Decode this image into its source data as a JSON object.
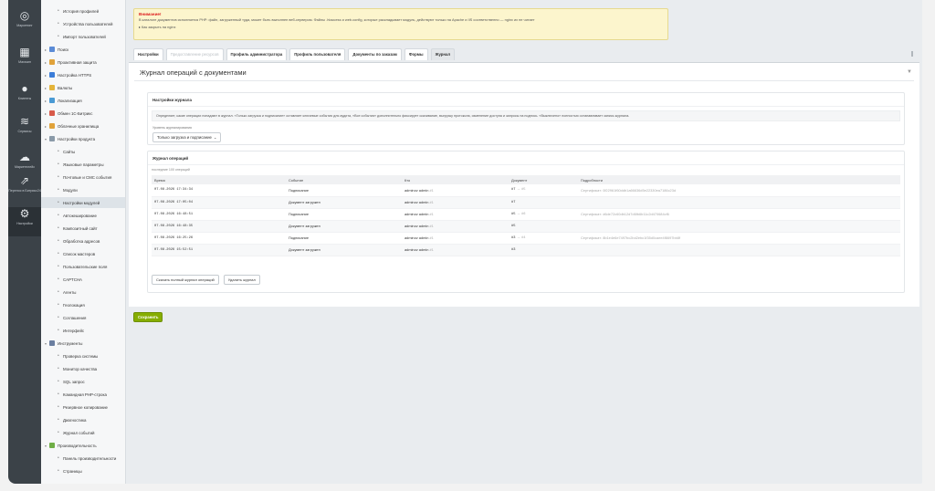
{
  "left_menu": [
    {
      "label": "Маркетинг",
      "icon": "target-icon",
      "glyph": "◎"
    },
    {
      "label": "Магазин",
      "icon": "shop-icon",
      "glyph": "▦"
    },
    {
      "label": "Клиенты",
      "icon": "clients-icon",
      "glyph": "●"
    },
    {
      "label": "Сервисы",
      "icon": "services-icon",
      "glyph": "≋"
    },
    {
      "label": "Маркетплейс",
      "icon": "marketplace-icon",
      "glyph": "☁"
    },
    {
      "label": "Перенос в Битрикс24",
      "icon": "migrate-icon",
      "glyph": "⇗"
    },
    {
      "label": "Настройки",
      "icon": "settings-icon",
      "glyph": "⚙"
    }
  ],
  "tree": [
    {
      "label": "История профилей",
      "kind": "sub"
    },
    {
      "label": "Устройства пользователей",
      "kind": "sub"
    },
    {
      "label": "Импорт пользователей",
      "kind": "sub"
    },
    {
      "label": "Поиск",
      "kind": "folder",
      "icon_color": "#5b8bd6"
    },
    {
      "label": "Проактивная защита",
      "kind": "folder",
      "icon_color": "#e0a23a"
    },
    {
      "label": "Настройка HTTPS",
      "kind": "folder",
      "icon_color": "#3b7dd8"
    },
    {
      "label": "Валюты",
      "kind": "folder",
      "icon_color": "#e4b43a"
    },
    {
      "label": "Локализация",
      "kind": "folder",
      "icon_color": "#4a9ad4"
    },
    {
      "label": "Обмен 1С-Битрикс",
      "kind": "folder",
      "icon_color": "#d85a4a"
    },
    {
      "label": "Облачные хранилища",
      "kind": "folder",
      "icon_color": "#e0a23a"
    },
    {
      "label": "Настройки продукта",
      "kind": "open",
      "icon_color": "#8a9aa8"
    },
    {
      "label": "Сайты",
      "kind": "sub"
    },
    {
      "label": "Языковые параметры",
      "kind": "sub"
    },
    {
      "label": "Почтовые и СМС события",
      "kind": "sub"
    },
    {
      "label": "Модули",
      "kind": "sub"
    },
    {
      "label": "Настройки модулей",
      "kind": "sub",
      "selected": true
    },
    {
      "label": "Автокеширование",
      "kind": "sub"
    },
    {
      "label": "Композитный сайт",
      "kind": "sub"
    },
    {
      "label": "Обработка адресов",
      "kind": "sub"
    },
    {
      "label": "Список мастеров",
      "kind": "sub"
    },
    {
      "label": "Пользовательские поля",
      "kind": "sub"
    },
    {
      "label": "CAPTCHA",
      "kind": "sub"
    },
    {
      "label": "Агенты",
      "kind": "sub"
    },
    {
      "label": "Геолокация",
      "kind": "sub"
    },
    {
      "label": "Соглашения",
      "kind": "sub"
    },
    {
      "label": "Интерфейс",
      "kind": "sub"
    },
    {
      "label": "Инструменты",
      "kind": "open",
      "icon_color": "#6a7ea0"
    },
    {
      "label": "Проверка системы",
      "kind": "sub"
    },
    {
      "label": "Монитор качества",
      "kind": "sub"
    },
    {
      "label": "SQL запрос",
      "kind": "sub"
    },
    {
      "label": "Командная PHP-строка",
      "kind": "sub"
    },
    {
      "label": "Резервное копирование",
      "kind": "sub"
    },
    {
      "label": "Диагностика",
      "kind": "sub"
    },
    {
      "label": "Журнал событий",
      "kind": "sub"
    },
    {
      "label": "Производительность",
      "kind": "open",
      "icon_color": "#6fae46"
    },
    {
      "label": "Панель производительности",
      "kind": "sub"
    },
    {
      "label": "Страницы",
      "kind": "sub"
    }
  ],
  "warning": {
    "title": "Внимание!",
    "text": "В каталоге документов исполняется PHP: файл, загруженный туда, может быть выполнен веб-сервером. Файлы .htaccess и web.config, которые раскладывает модуль, действуют только на Apache и IIS соответственно — nginx их не читает",
    "link": "▸ Как закрыть на nginx"
  },
  "tabs": [
    {
      "label": "Настройки",
      "state": "normal"
    },
    {
      "label": "Предоставление ресурсов",
      "state": "disabled"
    },
    {
      "label": "Профиль администратора",
      "state": "normal"
    },
    {
      "label": "Профиль пользователя",
      "state": "normal"
    },
    {
      "label": "Документы по заказам",
      "state": "normal"
    },
    {
      "label": "Формы",
      "state": "normal"
    },
    {
      "label": "Журнал",
      "state": "active"
    }
  ],
  "panel": {
    "title": "Журнал операций с документами",
    "settings_title": "Настройки журнала",
    "settings_desc": "Определяет, какие операции попадают в журнал. «Только загрузка и подписание» оставляет ключевые события для аудита, «Все события» дополнительно фиксирует скачивание, выгрузку протокола, изменение доступа и запросы на подпись. «Выключено» полностью останавливает запись журнала.",
    "level_label": "Уровень журналирования",
    "level_value": "Только загрузка и подписание",
    "ops_title": "Журнал операций",
    "ops_count": "последние 100 операций",
    "columns": [
      "Время",
      "Событие",
      "Кто",
      "Документ",
      "Подробности"
    ],
    "rows": [
      {
        "time": "07.08.2026 17:34:34",
        "event": "Подписание",
        "who": "adminov admin",
        "uid": "#1",
        "doc": "#7",
        "doc_to": "#5",
        "details": "Сертификат: 0f22961f60ddb1a66636d5e22330ea7186c23d"
      },
      {
        "time": "07.08.2026 17:05:04",
        "event": "Документ загружен",
        "who": "adminov admin",
        "uid": "#1",
        "doc": "#7",
        "doc_to": "",
        "details": ""
      },
      {
        "time": "07.08.2026 16:48:51",
        "event": "Подписание",
        "who": "adminov admin",
        "uid": "#1",
        "doc": "#5",
        "doc_to": "#6",
        "details": "Сертификат: d6de72c60db12d7d6fb6b11c2d470684cf6"
      },
      {
        "time": "07.08.2026 16:48:35",
        "event": "Документ загружен",
        "who": "adminov admin",
        "uid": "#1",
        "doc": "#5",
        "doc_to": "",
        "details": ""
      },
      {
        "time": "07.08.2026 16:25:26",
        "event": "Подписание",
        "who": "adminov admin",
        "uid": "#1",
        "doc": "#3",
        "doc_to": "#4",
        "details": "Сертификат: 8b1e4e6e7497bc2bd2ebc1f35d0caee4f8697bb8f"
      },
      {
        "time": "07.08.2026 15:52:51",
        "event": "Документ загружен",
        "who": "adminov admin",
        "uid": "#1",
        "doc": "#3",
        "doc_to": "",
        "details": ""
      }
    ],
    "download_label": "Скачать полный журнал операций",
    "delete_label": "Удалить журнал"
  },
  "save_label": "Сохранить"
}
